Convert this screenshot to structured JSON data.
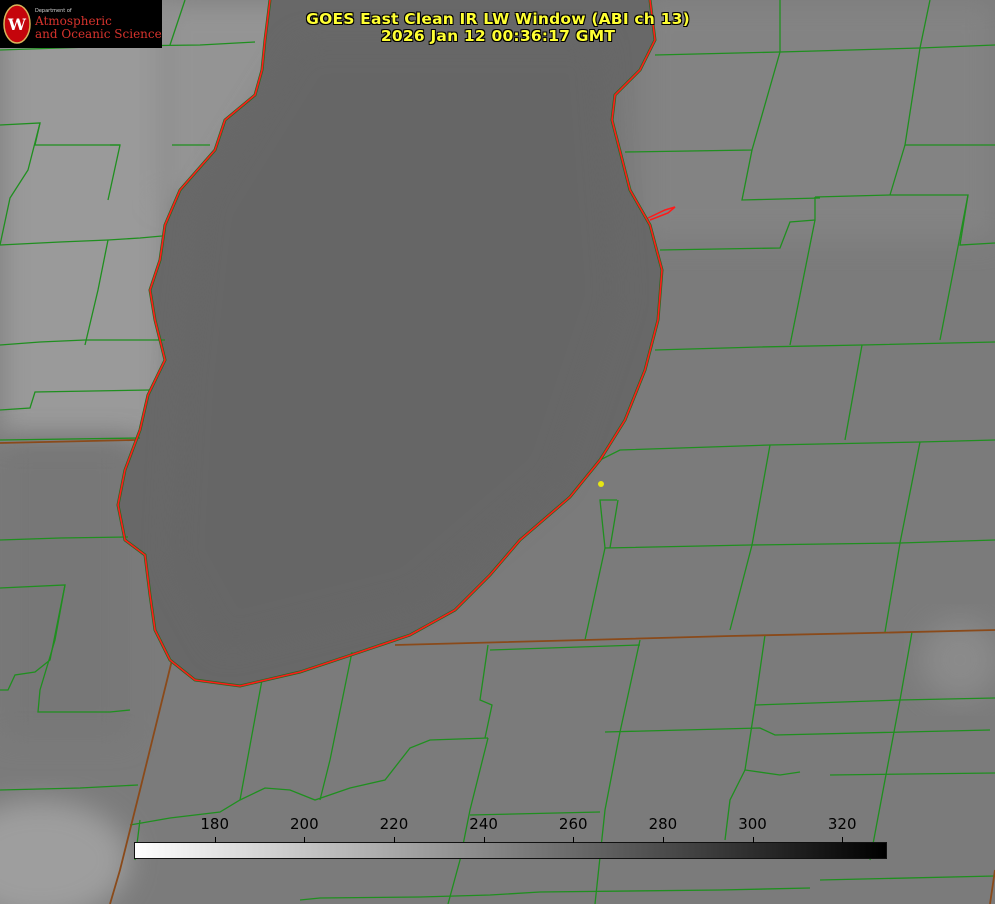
{
  "title": {
    "line1": "GOES East Clean IR LW Window (ABI ch 13)",
    "line2": "2026 Jan 12 00:36:17 GMT"
  },
  "logo": {
    "department": "Department of",
    "line1": "Atmospheric",
    "line2": "and Oceanic Sciences",
    "crest_letter": "W"
  },
  "colorbar": {
    "min": 162,
    "max": 330,
    "ticks": [
      "180",
      "200",
      "220",
      "240",
      "260",
      "280",
      "300",
      "320"
    ],
    "gradient": [
      "#ffffff",
      "#000000"
    ]
  },
  "colors": {
    "lake_outline": "#ff1a1a",
    "boundaries": "#1f8f1f",
    "state_line": "#8a4a1a",
    "title_text": "#ffff33",
    "marker": "#e6e614"
  }
}
